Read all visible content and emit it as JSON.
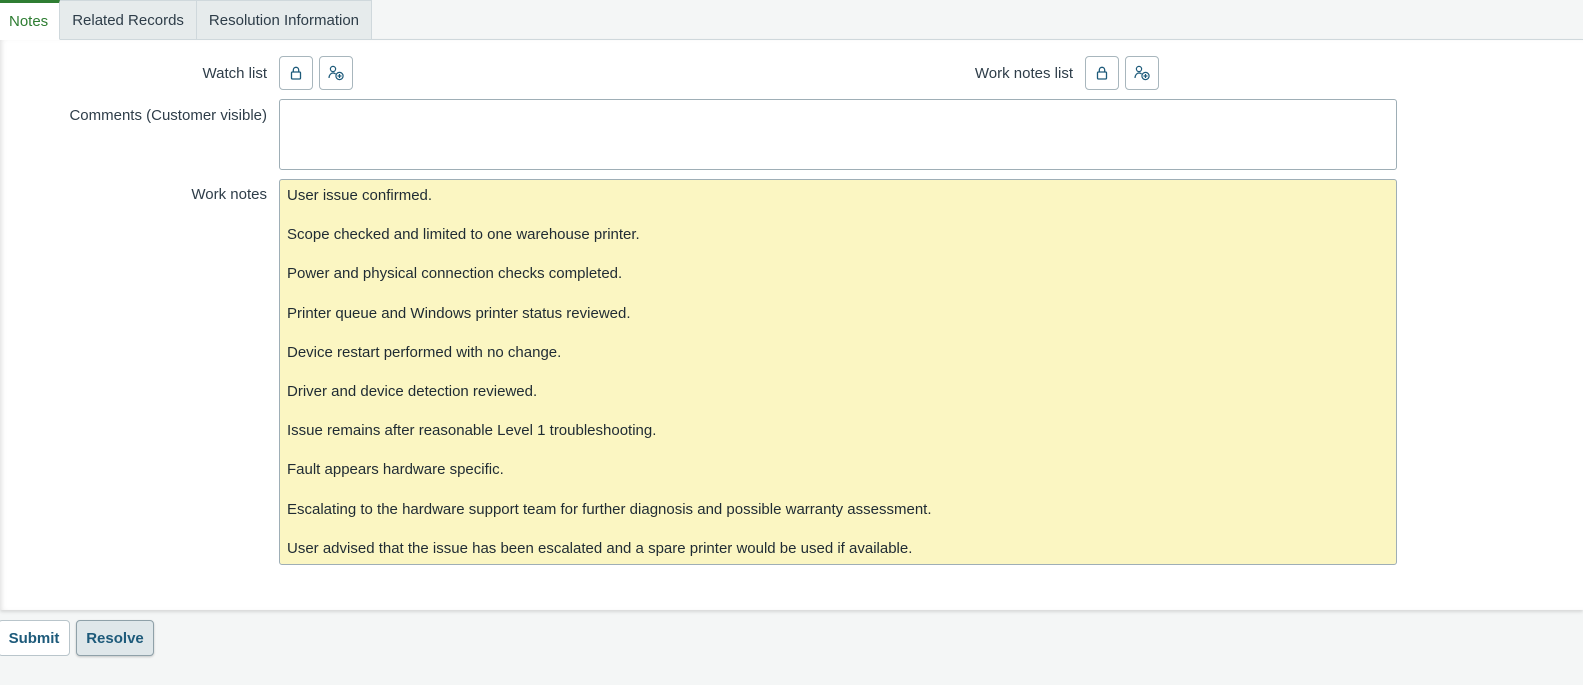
{
  "tabs": [
    {
      "label": "Notes",
      "active": true
    },
    {
      "label": "Related Records",
      "active": false
    },
    {
      "label": "Resolution Information",
      "active": false
    }
  ],
  "form": {
    "watch_list_label": "Watch list",
    "work_notes_list_label": "Work notes list",
    "comments_label": "Comments (Customer visible)",
    "comments_value": "",
    "work_notes_label": "Work notes",
    "work_notes_lines": [
      "User issue confirmed.",
      "Scope checked and limited to one warehouse printer.",
      "Power and physical connection checks completed.",
      "Printer queue and Windows printer status reviewed.",
      "Device restart performed with no change.",
      "Driver and device detection reviewed.",
      "Issue remains after reasonable Level 1 troubleshooting.",
      "Fault appears hardware specific.",
      "Escalating to the hardware support team for further diagnosis and possible warranty assessment.",
      "User advised that the issue has been escalated and a spare printer would be used if available."
    ]
  },
  "icons": {
    "lock": "lock-icon",
    "add_user": "add-user-icon"
  },
  "footer": {
    "submit_label": "Submit",
    "resolve_label": "Resolve"
  },
  "colors": {
    "active_tab_accent": "#2e7d32",
    "work_notes_background": "#fbf6c2",
    "button_text": "#1d5a7a"
  }
}
